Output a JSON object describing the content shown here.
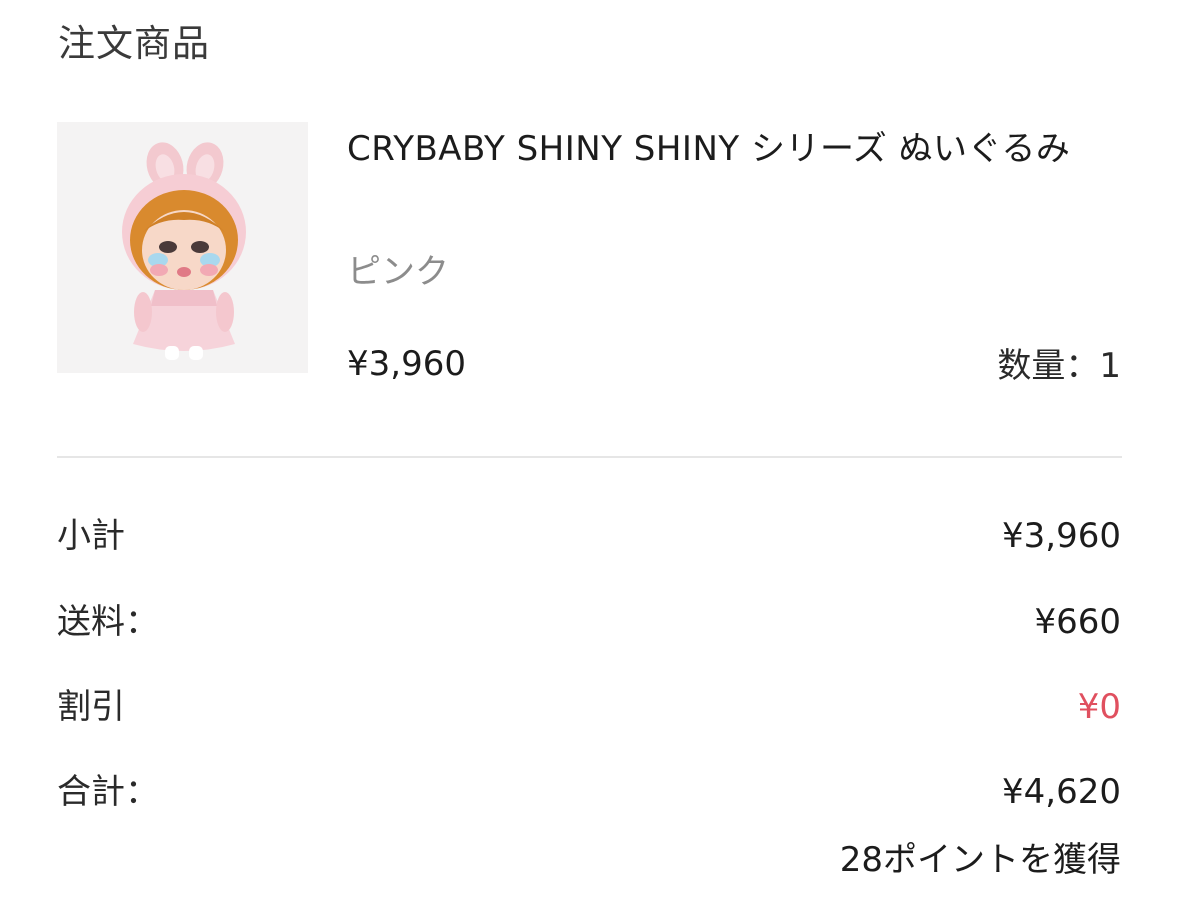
{
  "section": {
    "title": "注文商品"
  },
  "product": {
    "name": "CRYBABY SHINY SHINY シリーズ ぬいぐるみ",
    "variant": "ピンク",
    "price": "¥3,960",
    "quantity_text": "数量：1",
    "image_icon": "plush-doll-image"
  },
  "summary": {
    "subtotal_label": "小計",
    "subtotal_value": "¥3,960",
    "shipping_label": "送料：",
    "shipping_value": "¥660",
    "discount_label": "割引",
    "discount_value": "¥0",
    "total_label": "合計：",
    "total_value": "¥4,620",
    "points_note": "28ポイントを獲得"
  },
  "colors": {
    "discount": "#e0505f",
    "secondary_text": "#8c8c8c",
    "divider": "#e6e6e6"
  }
}
